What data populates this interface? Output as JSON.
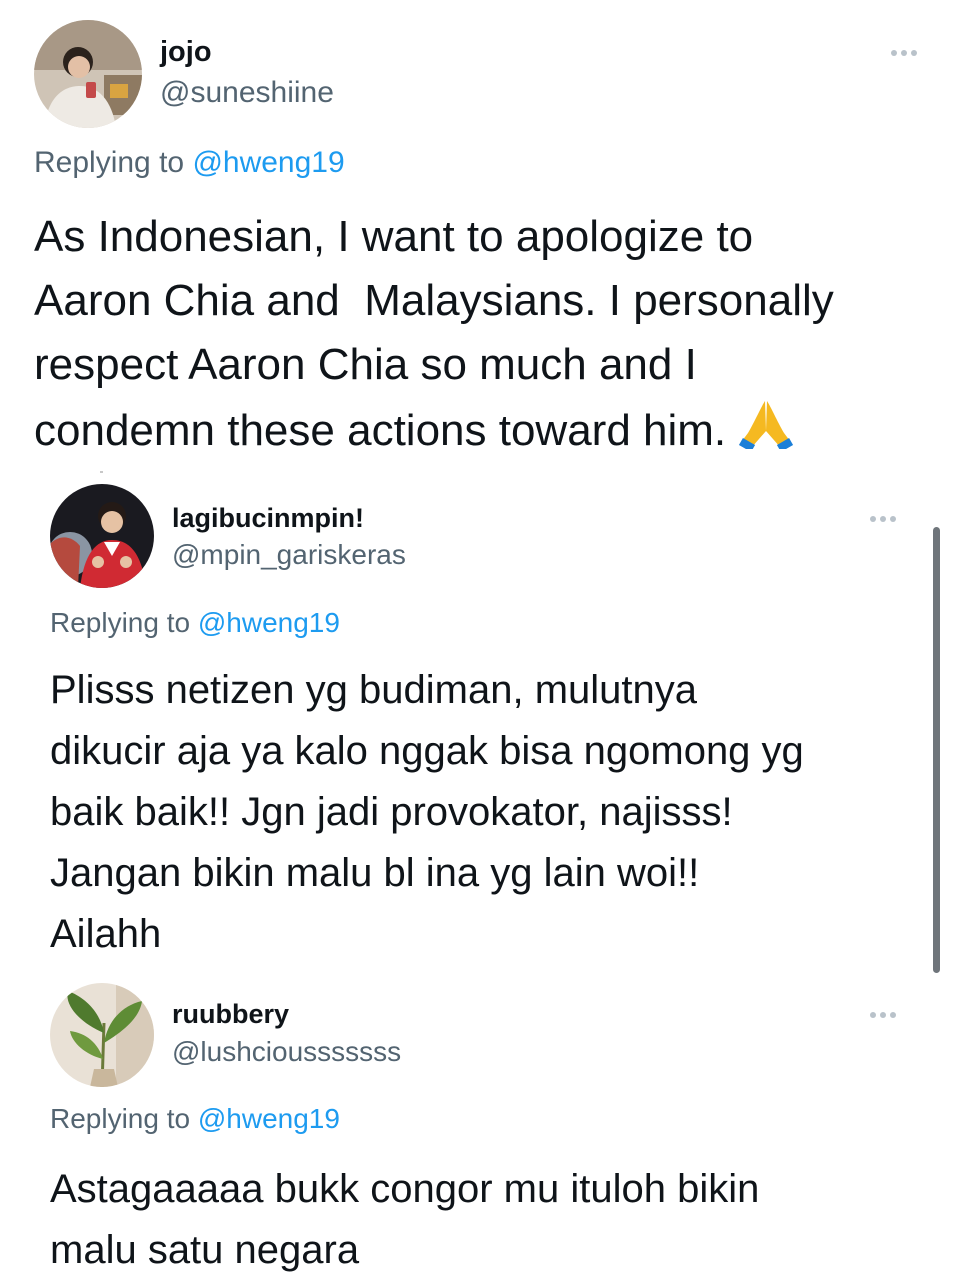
{
  "tweets": [
    {
      "name": "jojo",
      "handle": "@suneshiine",
      "replying_prefix": "Replying to ",
      "replying_to": "@hweng19",
      "text": "As Indonesian, I want to apologize to\nAaron Chia and  Malaysians. I personally\nrespect Aaron Chia so much and I\ncondemn these actions toward him. ",
      "emoji": "🙏"
    },
    {
      "name": "lagibucinmpin!",
      "handle": "@mpin_gariskeras",
      "replying_prefix": "Replying to ",
      "replying_to": "@hweng19",
      "text": "Plisss netizen yg budiman, mulutnya\ndikucir aja ya kalo nggak bisa ngomong yg\nbaik baik!! Jgn jadi provokator, najisss!\nJangan bikin malu bl ina yg lain woi!!\nAilahh"
    },
    {
      "name": "ruubbery",
      "handle": "@lushciousssssss",
      "replying_prefix": "Replying to ",
      "replying_to": "@hweng19",
      "text": "Astagaaaaa bukk congor mu ituloh bikin\nmalu satu negara"
    }
  ],
  "colors": {
    "text": "#0f1419",
    "secondary": "#536471",
    "link": "#1d9bf0",
    "background": "#ffffff",
    "more_dots": "#b9c2ca",
    "emoji": "#f5b921"
  },
  "icons": [
    "more-icon",
    "folded-hands-icon"
  ]
}
